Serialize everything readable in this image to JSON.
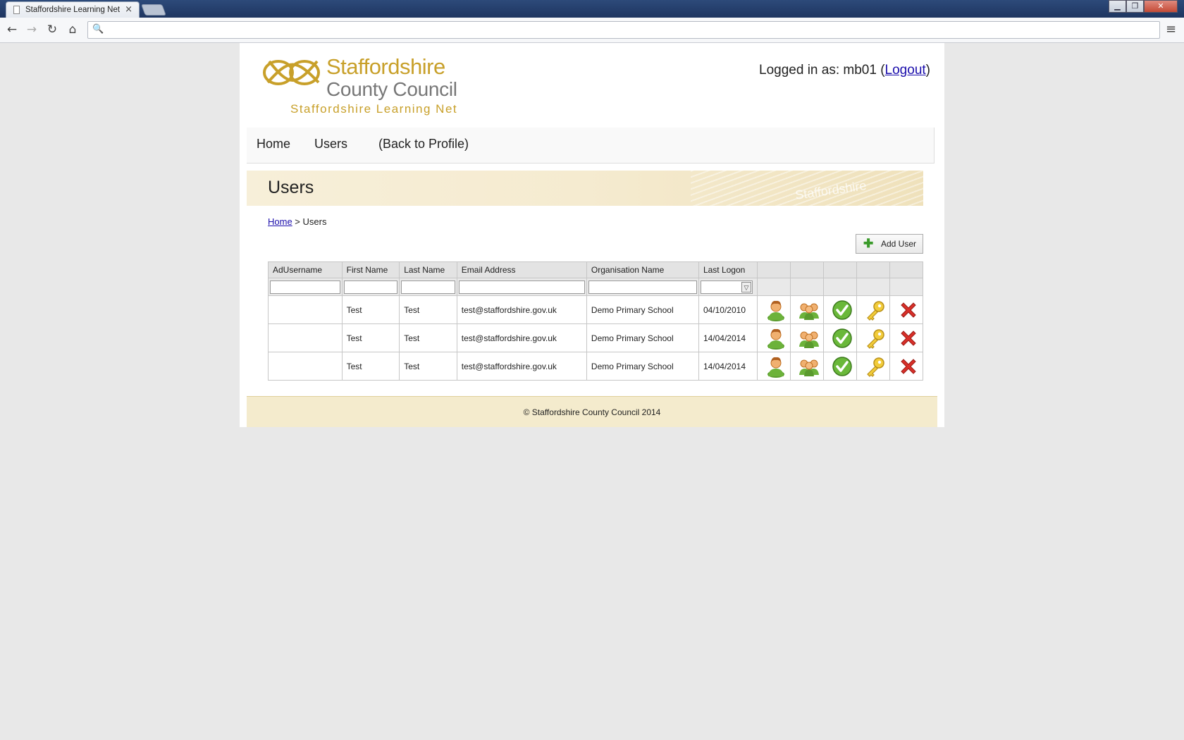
{
  "browser": {
    "tab_title": "Staffordshire Learning Net",
    "close_glyph": "×",
    "win_min": "▁",
    "win_max": "❐",
    "win_close": "✕",
    "nav_back": "←",
    "nav_fwd": "→",
    "nav_reload": "↻",
    "nav_home": "⌂",
    "search_glyph": "🔍",
    "menu_glyph": "≡"
  },
  "header": {
    "logo_line1": "Staffordshire",
    "logo_line2": "County Council",
    "logo_line3": "Staffordshire Learning Net",
    "logged_in_prefix": "Logged in as: mb01  (",
    "logout_label": "Logout",
    "logged_in_suffix": ")"
  },
  "nav": {
    "home": "Home",
    "users": "Users",
    "back_to_profile": "(Back to Profile)"
  },
  "page": {
    "title": "Users",
    "watermark": "Staffordshire",
    "breadcrumb_home": "Home",
    "breadcrumb_sep": " > ",
    "breadcrumb_current": "Users",
    "add_user_label": "Add User",
    "add_user_glyph": "✚"
  },
  "table": {
    "columns": [
      "AdUsername",
      "First Name",
      "Last Name",
      "Email Address",
      "Organisation Name",
      "Last Logon"
    ],
    "date_filter_arrow": "▽",
    "rows": [
      {
        "ad_username": "",
        "first_name": "Test",
        "last_name": "Test",
        "email": "test@staffordshire.gov.uk",
        "organisation": "Demo Primary School",
        "last_logon": "04/10/2010"
      },
      {
        "ad_username": "",
        "first_name": "Test",
        "last_name": "Test",
        "email": "test@staffordshire.gov.uk",
        "organisation": "Demo Primary School",
        "last_logon": "14/04/2014"
      },
      {
        "ad_username": "",
        "first_name": "Test",
        "last_name": "Test",
        "email": "test@staffordshire.gov.uk",
        "organisation": "Demo Primary School",
        "last_logon": "14/04/2014"
      }
    ],
    "row_icons": [
      "user-icon",
      "group-icon",
      "approve-icon",
      "key-icon",
      "delete-icon"
    ]
  },
  "footer": {
    "copyright": "© Staffordshire County Council 2014"
  },
  "colors": {
    "brand_gold": "#c8a02a",
    "brand_grey": "#777777",
    "footer_bg": "#f4ebcd",
    "link": "#1a0dab"
  }
}
